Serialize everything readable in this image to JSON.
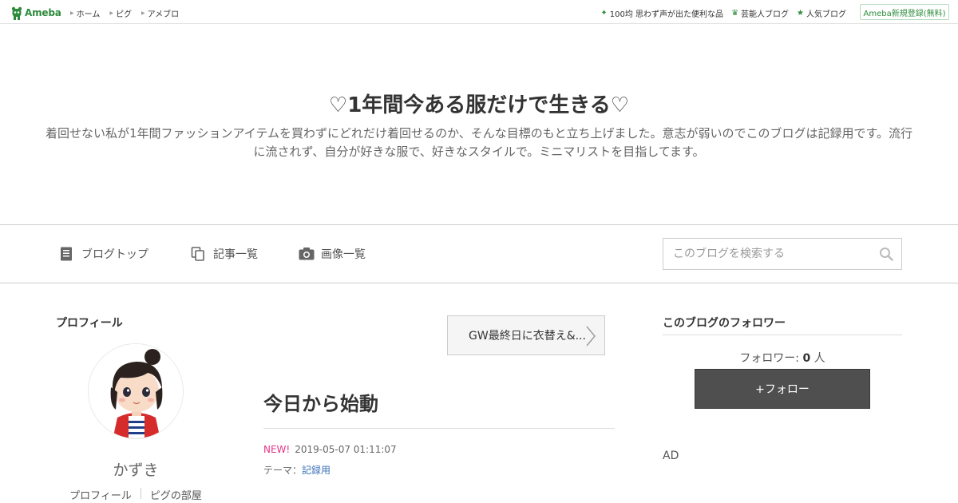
{
  "topbar": {
    "logo_text": "Ameba",
    "nav": [
      "ホーム",
      "ピグ",
      "アメブロ"
    ],
    "links": [
      {
        "icon": "sparkle-icon",
        "label": "100均 思わず声が出た便利な品"
      },
      {
        "icon": "crown-icon",
        "label": "芸能人ブログ"
      },
      {
        "icon": "star-icon",
        "label": "人気ブログ"
      }
    ],
    "register_label": "Ameba新規登録(無料)"
  },
  "header": {
    "title": "♡1年間今ある服だけで生きる♡",
    "description": "着回せない私が1年間ファッションアイテムを買わずにどれだけ着回せるのか、そんな目標のもと立ち上げました。意志が弱いのでこのブログは記録用です。流行に流されず、自分が好きな服で、好きなスタイルで。ミニマリストを目指してます。"
  },
  "nav": {
    "items": [
      {
        "icon": "document-icon",
        "label": "ブログトップ"
      },
      {
        "icon": "copy-pages-icon",
        "label": "記事一覧"
      },
      {
        "icon": "camera-icon",
        "label": "画像一覧"
      }
    ],
    "search_placeholder": "このブログを検索する"
  },
  "profile": {
    "section_title": "プロフィール",
    "nickname": "かずき",
    "links": [
      "プロフィール",
      "ピグの部屋"
    ]
  },
  "entry": {
    "next_entry_label": "GW最終日に衣替え&...",
    "title": "今日から始動",
    "new_badge": "NEW!",
    "datetime": "2019-05-07 01:11:07",
    "theme_prefix": "テーマ：",
    "theme": "記録用"
  },
  "followers": {
    "section_title": "このブログのフォロワー",
    "count_prefix": "フォロワー: ",
    "count": "0",
    "count_suffix": " 人",
    "follow_label": "+フォロー"
  },
  "ad": {
    "label": "AD"
  },
  "colors": {
    "ameba_green": "#2d8c3c",
    "new_pink": "#e5338a",
    "link_blue": "#3a70b8",
    "follow_button": "#4f4f4f"
  }
}
